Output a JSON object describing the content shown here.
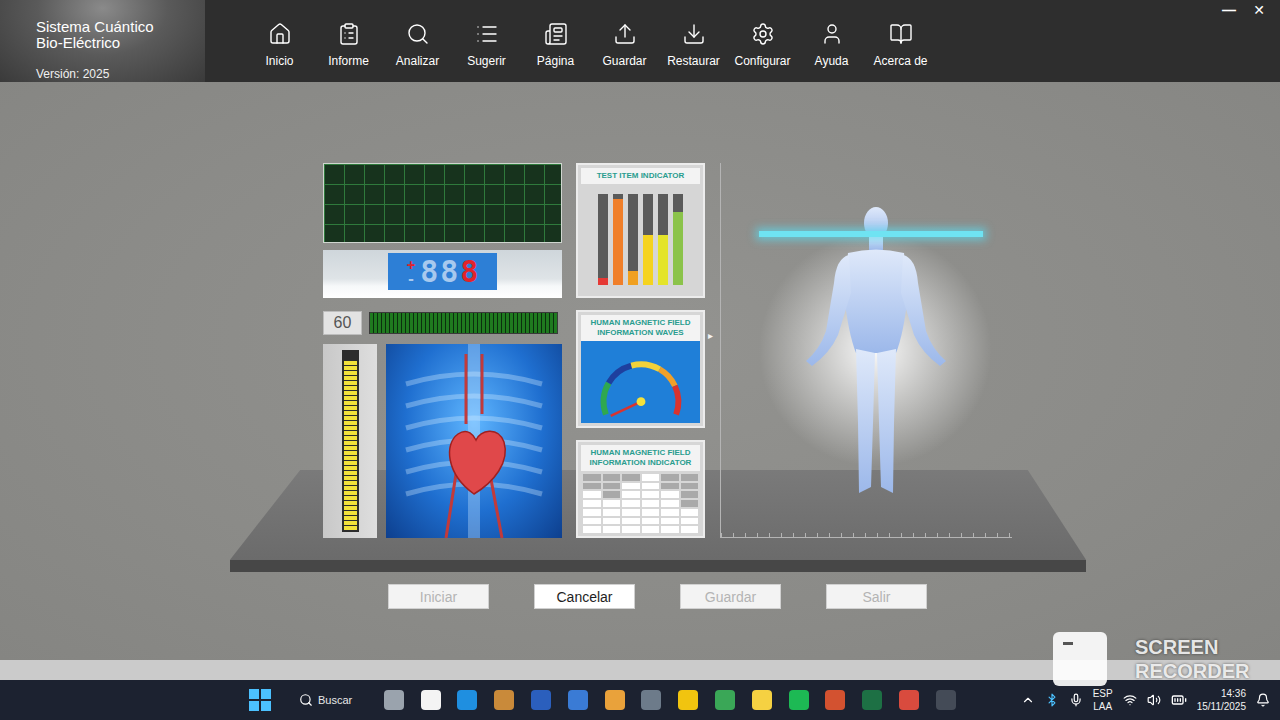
{
  "window": {
    "title": "Sistema Cuántico",
    "subtitle": "Bio-Eléctrico",
    "version": "Versión: 2025",
    "controls": [
      "—",
      "✕"
    ]
  },
  "toolbar": [
    {
      "label": "Inicio"
    },
    {
      "label": "Informe"
    },
    {
      "label": "Analizar"
    },
    {
      "label": "Sugerir"
    },
    {
      "label": "Página"
    },
    {
      "label": "Guardar"
    },
    {
      "label": "Restaurar"
    },
    {
      "label": "Configurar"
    },
    {
      "label": "Ayuda"
    },
    {
      "label": "Acerca de"
    }
  ],
  "display": {
    "signs": [
      {
        "char": "+",
        "lit": true
      },
      {
        "char": "-",
        "lit": false
      }
    ],
    "digits": [
      {
        "char": "8",
        "lit": false
      },
      {
        "char": "8",
        "lit": false
      },
      {
        "char": "8",
        "lit": true
      }
    ]
  },
  "timer": {
    "value": "60",
    "level": 1
  },
  "level_meter": {
    "level": 0.95
  },
  "test_item_indicator": {
    "title": "TEST ITEM INDICATOR",
    "bars": [
      {
        "level": 0.08,
        "color": "#e53935"
      },
      {
        "level": 0.95,
        "color": "#f07f2a"
      },
      {
        "level": 0.15,
        "color": "#f0a020"
      },
      {
        "level": 0.55,
        "color": "#f5d31f"
      },
      {
        "level": 0.55,
        "color": "#e4e42a"
      },
      {
        "level": 0.8,
        "color": "#8bc34a"
      }
    ]
  },
  "waves": {
    "title": "HUMAN MAGNETIC FIELD INFORMATION WAVES",
    "level": 0.02
  },
  "field_indicator": {
    "title": "HUMAN MAGNETIC FIELD INFORMATION INDICATOR",
    "columns": [
      {
        "level": 0.71
      },
      {
        "level": 0.57
      },
      {
        "level": 0.86
      },
      {
        "level": 1
      },
      {
        "level": 0.71
      },
      {
        "level": 0.43
      }
    ]
  },
  "expand_glyph": "▸",
  "buttons": [
    {
      "label": "Iniciar",
      "disabled": true
    },
    {
      "label": "Cancelar",
      "disabled": false
    },
    {
      "label": "Guardar",
      "disabled": true
    },
    {
      "label": "Salir",
      "disabled": true
    }
  ],
  "watermark": {
    "lines": [
      "SCREEN",
      "RECORDER"
    ]
  },
  "taskbar": {
    "search": "Buscar",
    "language": "ESP",
    "layout": "LAA",
    "time": "14:36",
    "date": "15/11/2025"
  }
}
